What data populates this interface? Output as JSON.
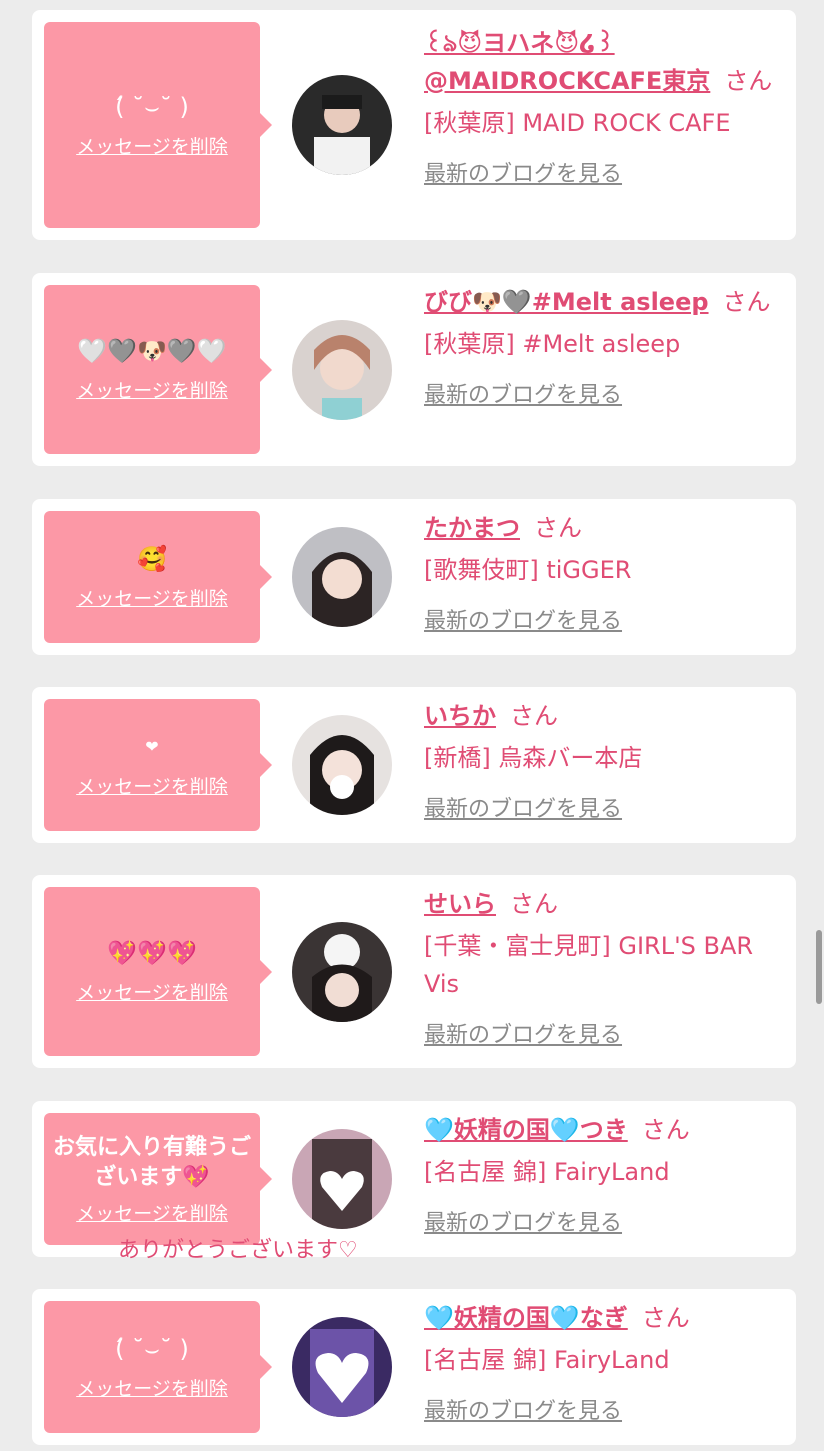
{
  "colors": {
    "accent_pink": "#e04c74",
    "bubble_pink": "#fc98a6",
    "background": "#ececec",
    "link_gray": "#8a8a8a"
  },
  "labels": {
    "delete_message": "メッセージを削除",
    "view_blog": "最新のブログを見る",
    "san": "さん"
  },
  "cards": [
    {
      "message": "(́ ˘⌣˘ )",
      "name": "꒰ঌ😈ヨハネ😈໒꒱@MAIDROCKCAFE東京",
      "shop": "[秋葉原] MAID ROCK CAFE"
    },
    {
      "message": "🤍🩶🐶🩶🤍",
      "name": "びび🐶🩶#Melt asleep",
      "shop": "[秋葉原] #Melt asleep"
    },
    {
      "message": "🥰",
      "name": "たかまつ",
      "shop": "[歌舞伎町] tiGGER"
    },
    {
      "message": "❤",
      "name": "いちか",
      "shop": "[新橋] 烏森バー本店"
    },
    {
      "message": "💖💖💖",
      "name": "せいら",
      "shop": "[千葉・富士見町] GIRL'S BAR Vis"
    },
    {
      "message": "お気に入り有難うございます💖",
      "name": "🩵妖精の国🩵つき",
      "shop": "[名古屋 錦] FairyLand",
      "reply": "ありがとうございます♡"
    },
    {
      "message": "(́ ˘⌣˘ )",
      "name": "🩵妖精の国🩵なぎ",
      "shop": "[名古屋 錦] FairyLand"
    }
  ]
}
